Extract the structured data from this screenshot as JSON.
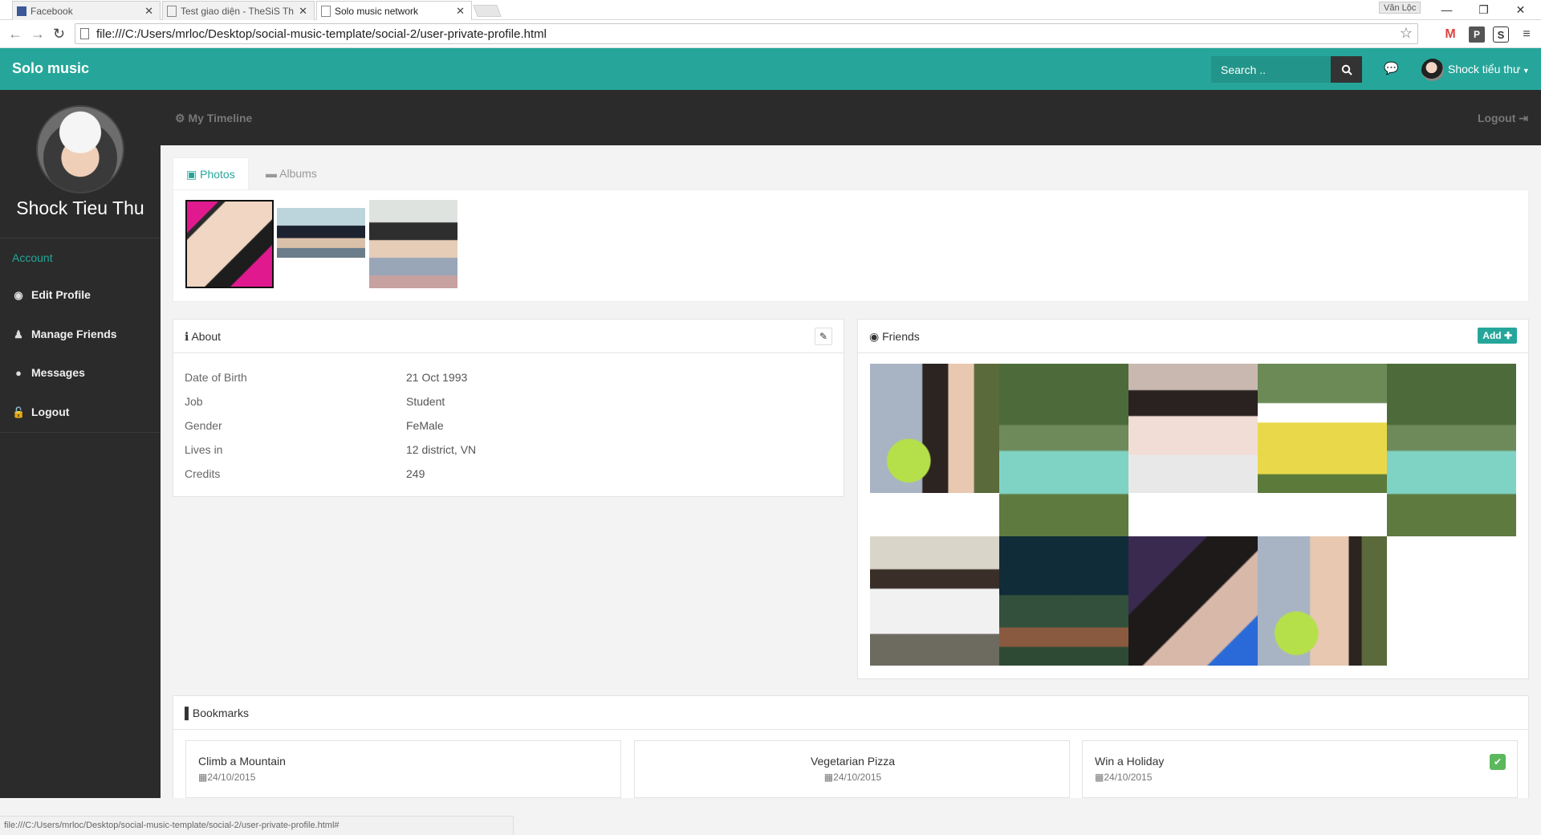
{
  "browser": {
    "tabs": [
      {
        "label": "Facebook"
      },
      {
        "label": "Test giao diện - TheSiS Th"
      },
      {
        "label": "Solo music network"
      }
    ],
    "window_user": "Văn Lộc",
    "url": "file:///C:/Users/mrloc/Desktop/social-music-template/social-2/user-private-profile.html",
    "status_url": "file:///C:/Users/mrloc/Desktop/social-music-template/social-2/user-private-profile.html#"
  },
  "topbar": {
    "brand": "Solo music",
    "search_placeholder": "Search ..",
    "user_name": "Shock tiểu thư"
  },
  "sidebar": {
    "name": "Shock Tieu Thu",
    "section": "Account",
    "items": [
      {
        "label": "Edit Profile",
        "icon": "user-circle-icon"
      },
      {
        "label": "Manage Friends",
        "icon": "users-icon"
      },
      {
        "label": "Messages",
        "icon": "comment-icon"
      },
      {
        "label": "Logout",
        "icon": "lock-icon"
      }
    ]
  },
  "subbar": {
    "timeline": "My Timeline",
    "logout": "Logout"
  },
  "photos": {
    "tabs": [
      "Photos",
      "Albums"
    ]
  },
  "about": {
    "title": "About",
    "rows": [
      {
        "label": "Date of Birth",
        "value": "21 Oct 1993"
      },
      {
        "label": "Job",
        "value": "Student"
      },
      {
        "label": "Gender",
        "value": "FeMale"
      },
      {
        "label": "Lives in",
        "value": "12 district, VN"
      },
      {
        "label": "Credits",
        "value": "249"
      }
    ]
  },
  "friends": {
    "title": "Friends",
    "add_label": "Add"
  },
  "bookmarks": {
    "title": "Bookmarks",
    "items": [
      {
        "title": "Climb a Mountain",
        "date": "24/10/2015"
      },
      {
        "title": "Vegetarian Pizza",
        "date": "24/10/2015"
      },
      {
        "title": "Win a Holiday",
        "date": "24/10/2015"
      }
    ]
  },
  "colors": {
    "accent": "#26a69a",
    "dark": "#2b2b2b"
  }
}
